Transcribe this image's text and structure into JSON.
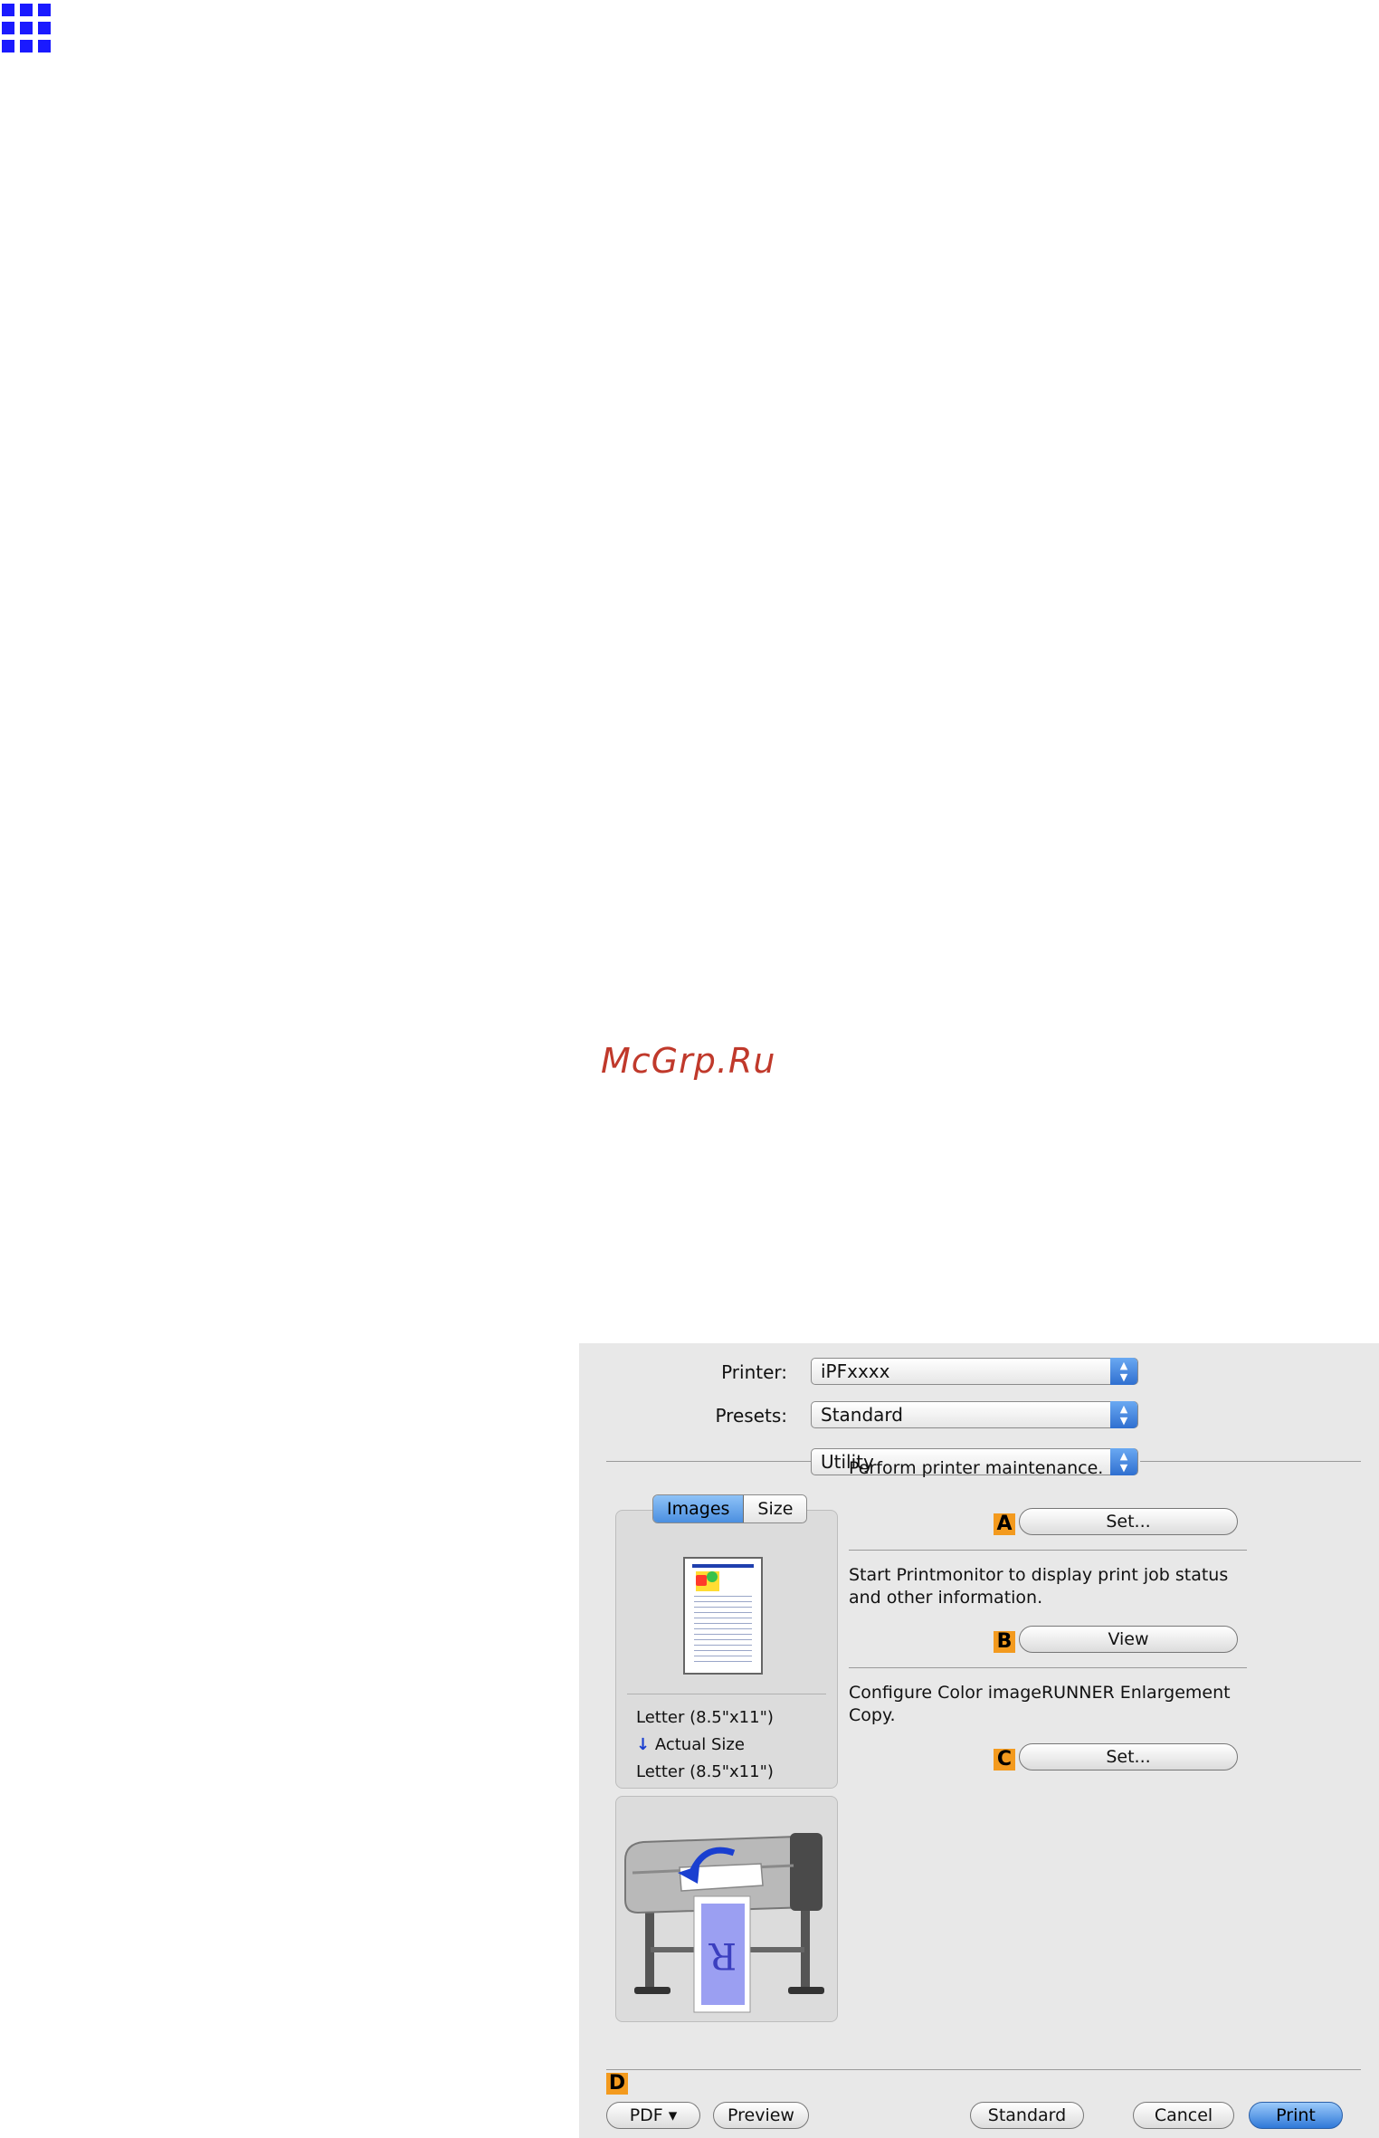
{
  "page": {
    "watermark": "McGrp.Ru"
  },
  "dialog": {
    "printer": {
      "label": "Printer:",
      "value": "iPFxxxx"
    },
    "presets": {
      "label": "Presets:",
      "value": "Standard"
    },
    "pane": {
      "value": "Utility"
    },
    "preview": {
      "tabs": [
        "Images",
        "Size"
      ],
      "info": [
        "Letter (8.5\"x11\")",
        "Actual Size",
        "Letter (8.5\"x11\")"
      ]
    },
    "sections": [
      {
        "description": "Perform printer maintenance.",
        "badge": "A",
        "button": "Set..."
      },
      {
        "description": "Start Printmonitor to display print job status and other information.",
        "badge": "B",
        "button": "View"
      },
      {
        "description": "Configure Color imageRUNNER Enlargement Copy.",
        "badge": "C",
        "button": "Set..."
      }
    ],
    "footer": {
      "badge": "D",
      "pdf": "PDF ▾",
      "preview": "Preview",
      "standard": "Standard",
      "cancel": "Cancel",
      "print": "Print"
    }
  },
  "colors": {
    "badge": "#f39a1e",
    "accent_blue": "#2e78d8",
    "grid_icon": "#1a1aff"
  }
}
